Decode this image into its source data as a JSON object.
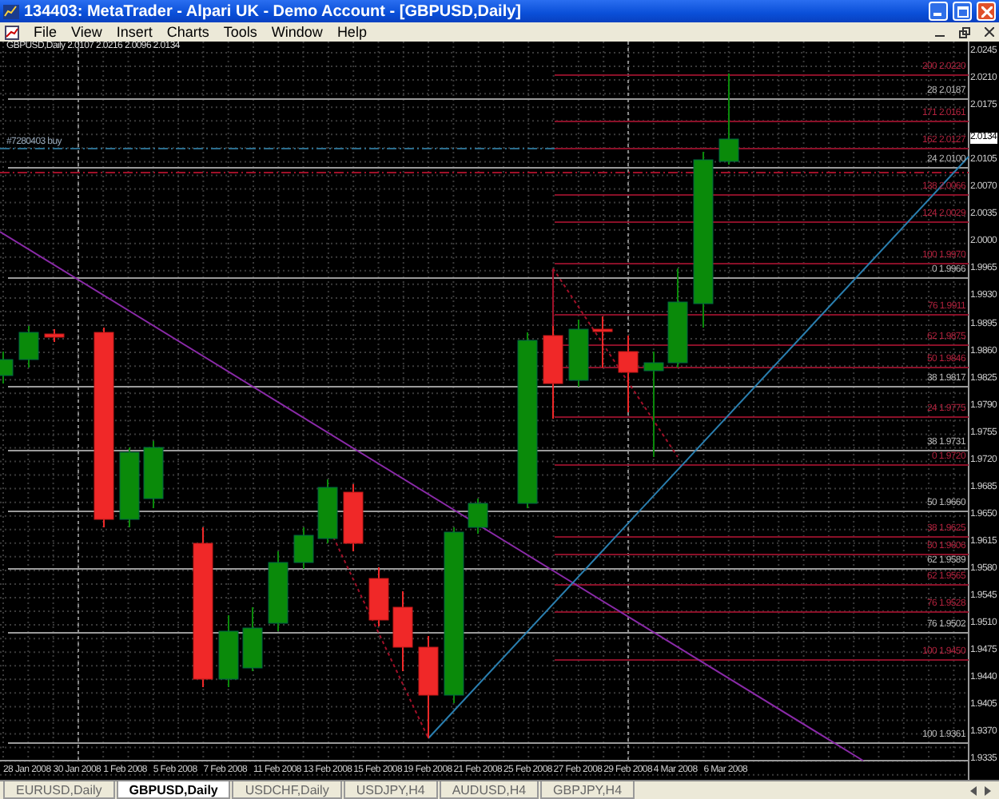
{
  "window": {
    "title": "134403: MetaTrader - Alpari UK - Demo Account - [GBPUSD,Daily]"
  },
  "menu": [
    "File",
    "View",
    "Insert",
    "Charts",
    "Tools",
    "Window",
    "Help"
  ],
  "chart": {
    "header": "GBPUSD,Daily  2.0107 2.0216 2.0096 2.0134",
    "order_label": "#7280403 buy",
    "current_price": "2.0134",
    "price_axis": [
      "2.0245",
      "2.0210",
      "2.0175",
      "2.0105",
      "2.0070",
      "2.0035",
      "2.0000",
      "1.9965",
      "1.9930",
      "1.9895",
      "1.9860",
      "1.9825",
      "1.9790",
      "1.9755",
      "1.9720",
      "1.9685",
      "1.9650",
      "1.9615",
      "1.9580",
      "1.9545",
      "1.9510",
      "1.9475",
      "1.9440",
      "1.9405",
      "1.9370",
      "1.9335"
    ],
    "date_axis": [
      "28 Jan 2008",
      "30 Jan 2008",
      "1 Feb 2008",
      "5 Feb 2008",
      "7 Feb 2008",
      "11 Feb 2008",
      "13 Feb 2008",
      "15 Feb 2008",
      "19 Feb 2008",
      "21 Feb 2008",
      "25 Feb 2008",
      "27 Feb 2008",
      "29 Feb 2008",
      "4 Mar 2008",
      "6 Mar 2008"
    ],
    "levels": [
      {
        "label": "200 2.0220",
        "kind": "fib"
      },
      {
        "label": "28 2.0187",
        "kind": "base"
      },
      {
        "label": "171 2.0161",
        "kind": "fib"
      },
      {
        "label": "162 2.0127",
        "kind": "fib"
      },
      {
        "label": "24 2.0100",
        "kind": "base"
      },
      {
        "label": "138 2.0066",
        "kind": "fib"
      },
      {
        "label": "124 2.0029",
        "kind": "fib"
      },
      {
        "label": "100 1.9970",
        "kind": "fib"
      },
      {
        "label": "0 1.9966",
        "kind": "base"
      },
      {
        "label": "76 1.9911",
        "kind": "fib"
      },
      {
        "label": "62 1.9875",
        "kind": "fib"
      },
      {
        "label": "50 1.9846",
        "kind": "fib"
      },
      {
        "label": "38 1.9817",
        "kind": "base"
      },
      {
        "label": "24 1.9775",
        "kind": "fib"
      },
      {
        "label": "38 1.9731",
        "kind": "base"
      },
      {
        "label": "0 1.9720",
        "kind": "fib"
      },
      {
        "label": "50 1.9660",
        "kind": "base"
      },
      {
        "label": "38 1.9625",
        "kind": "fib"
      },
      {
        "label": "50 1.9606",
        "kind": "fib"
      },
      {
        "label": "62 1.9589",
        "kind": "base"
      },
      {
        "label": "62 1.9565",
        "kind": "fib"
      },
      {
        "label": "76 1.9528",
        "kind": "fib"
      },
      {
        "label": "76 1.9502",
        "kind": "base"
      },
      {
        "label": "100 1.9450",
        "kind": "fib"
      },
      {
        "label": "100 1.9361",
        "kind": "base"
      }
    ]
  },
  "tabs": [
    {
      "label": "EURUSD,Daily",
      "selected": false
    },
    {
      "label": "GBPUSD,Daily",
      "selected": true
    },
    {
      "label": "USDCHF,Daily",
      "selected": false
    },
    {
      "label": "USDJPY,H4",
      "selected": false
    },
    {
      "label": "AUDUSD,H4",
      "selected": false
    },
    {
      "label": "GBPJPY,H4",
      "selected": false
    }
  ]
}
